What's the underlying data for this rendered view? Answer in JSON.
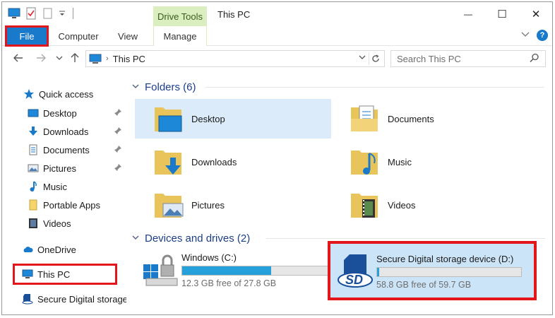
{
  "window": {
    "title": "This PC",
    "context_tab": "Drive Tools",
    "minimize": "—",
    "maximize": "☐",
    "close": "✕"
  },
  "ribbon": {
    "tabs": [
      {
        "label": "File",
        "selected": true
      },
      {
        "label": "Computer"
      },
      {
        "label": "View"
      },
      {
        "label": "Manage"
      }
    ],
    "help": "?"
  },
  "address": {
    "breadcrumb": "This PC",
    "search_placeholder": "Search This PC"
  },
  "nav": {
    "items": [
      {
        "label": "Quick access",
        "icon": "star-icon"
      },
      {
        "label": "Desktop",
        "icon": "desktop-icon",
        "pinned": true
      },
      {
        "label": "Downloads",
        "icon": "download-icon",
        "pinned": true
      },
      {
        "label": "Documents",
        "icon": "document-icon",
        "pinned": true
      },
      {
        "label": "Pictures",
        "icon": "picture-icon",
        "pinned": true
      },
      {
        "label": "Music",
        "icon": "music-icon"
      },
      {
        "label": "Portable Apps",
        "icon": "folder-icon"
      },
      {
        "label": "Videos",
        "icon": "video-icon"
      },
      {
        "label": "OneDrive",
        "icon": "cloud-icon"
      },
      {
        "label": "This PC",
        "icon": "computer-icon",
        "selected": true
      },
      {
        "label": "Secure Digital storage",
        "icon": "sd-card-icon"
      }
    ]
  },
  "content": {
    "folders_header": "Folders (6)",
    "folders": [
      {
        "label": "Desktop",
        "selected": true
      },
      {
        "label": "Documents"
      },
      {
        "label": "Downloads"
      },
      {
        "label": "Music"
      },
      {
        "label": "Pictures"
      },
      {
        "label": "Videos"
      }
    ],
    "drives_header": "Devices and drives (2)",
    "drives": [
      {
        "name": "Windows (C:)",
        "free": "12.3 GB free of 27.8 GB",
        "used_fraction": 0.557
      },
      {
        "name": "Secure Digital storage device (D:)",
        "free": "58.8 GB free of 59.7 GB",
        "used_fraction": 0.015,
        "selected": true
      }
    ]
  },
  "colors": {
    "accent": "#1979ca",
    "highlight_box": "#e3161b",
    "drive_tools": "#dbeec0",
    "selection": "#cce4f7",
    "bar_fill": "#26a0da"
  }
}
